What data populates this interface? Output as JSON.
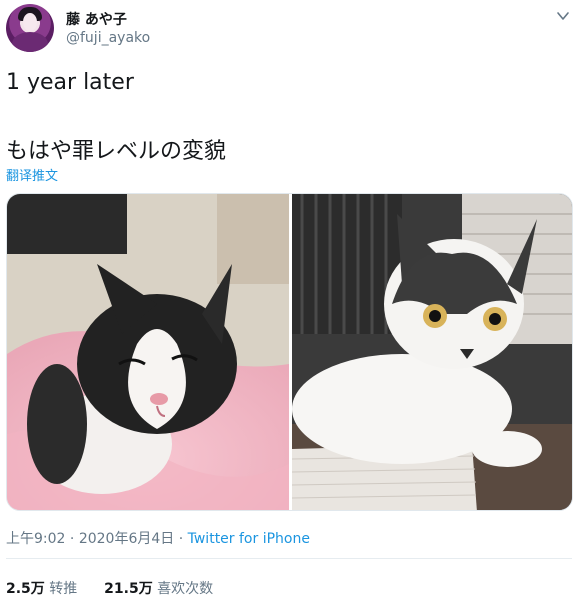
{
  "author": {
    "display_name": "藤 あや子",
    "handle": "@fuji_ayako"
  },
  "tweet": {
    "line1": "1 year later",
    "line2": "もはや罪レベルの変貌",
    "translate_label": "翻译推文"
  },
  "media": {
    "images": [
      {
        "subject": "black-and-white kitten on pink blanket"
      },
      {
        "subject": "grown black-and-white cat lying on table"
      }
    ]
  },
  "meta": {
    "time": "上午9:02",
    "separator": " · ",
    "date": "2020年6月4日",
    "separator2": " · ",
    "source": "Twitter for iPhone"
  },
  "stats": {
    "retweets_count": "2.5万",
    "retweets_label": "转推",
    "likes_count": "21.5万",
    "likes_label": "喜欢次数"
  },
  "colors": {
    "link": "#1b95e0",
    "muted": "#657786",
    "text": "#14171a",
    "kitten_blanket": "#f4b9c6"
  },
  "icons": {
    "caret": "chevron-down-icon"
  }
}
